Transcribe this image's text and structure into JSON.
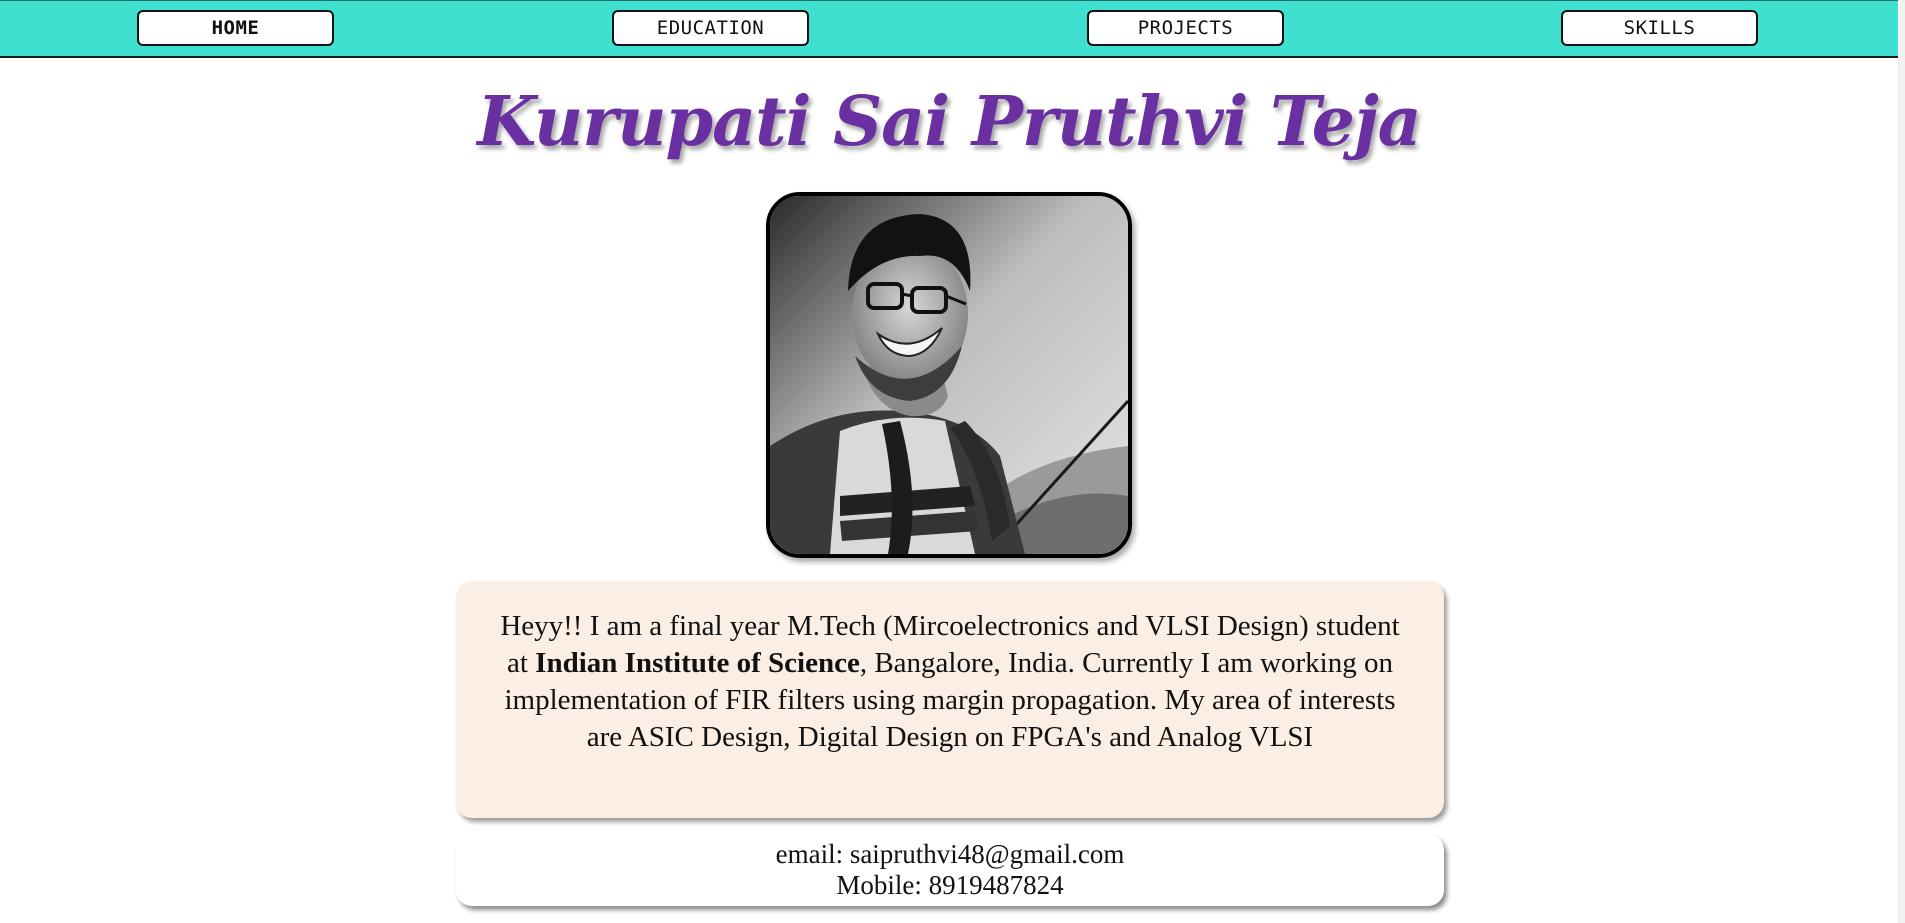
{
  "nav": {
    "home": "HOME",
    "education": "EDUCATION",
    "projects": "PROJECTS",
    "skills": "SKILLS",
    "active": "HOME"
  },
  "profile": {
    "name": "Kurupati Sai Pruthvi Teja",
    "photo_icon": "profile-photo"
  },
  "bio": {
    "part1": "Heyy!! I am a final year M.Tech (Mircoelectronics and VLSI Design) student at ",
    "institute": "Indian Institute of Science",
    "part2": ", Bangalore, India. Currently I am working on implementation of FIR filters using margin propagation. My area of interests are ASIC Design, Digital Design on FPGA's and Analog VLSI"
  },
  "contact": {
    "email": "email: saipruthvi48@gmail.com",
    "mobile": "Mobile: 8919487824"
  },
  "colors": {
    "navbar": "#40e0d0",
    "title": "#6a2fa0",
    "bio_background": "#faeee5"
  }
}
